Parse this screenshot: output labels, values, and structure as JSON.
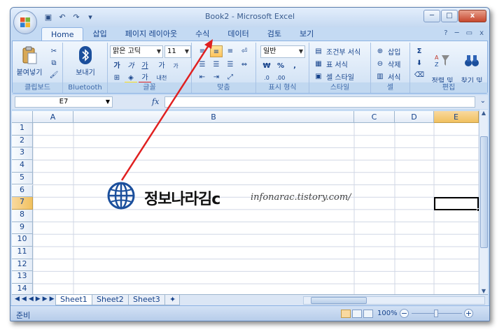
{
  "window": {
    "title": "Book2 - Microsoft Excel",
    "controls": {
      "minimize": "─",
      "restore": "□",
      "close": "x"
    }
  },
  "quick_access": {
    "save": "save-icon",
    "undo": "undo-icon",
    "redo": "redo-icon",
    "customize": "▾"
  },
  "ribbon": {
    "tabs": [
      {
        "label": "Home",
        "active": true
      },
      {
        "label": "삽입"
      },
      {
        "label": "페이지 레이아웃"
      },
      {
        "label": "수식"
      },
      {
        "label": "데이터"
      },
      {
        "label": "검토"
      },
      {
        "label": "보기"
      }
    ],
    "right_controls": {
      "help": "?",
      "minimize": "─",
      "restore": "▭",
      "close": "x"
    },
    "groups": {
      "clipboard": {
        "label": "클립보드",
        "paste": "붙여넣기"
      },
      "bluetooth": {
        "label": "Bluetooth",
        "send": "보내기"
      },
      "font": {
        "label": "글꼴",
        "font_name": "맑은 고딕",
        "font_size": "11",
        "bold": "가",
        "italic": "가",
        "underline": "가",
        "grow": "가",
        "shrink": "가",
        "font_color": "가",
        "phonetic": "내천"
      },
      "alignment": {
        "label": "맞춤"
      },
      "number": {
        "label": "표시 형식",
        "format": "일반",
        "currency": "₩",
        "percent": "%",
        "comma": ",",
        "inc": ".0",
        "dec": ".00"
      },
      "styles": {
        "label": "스타일",
        "conditional": "조건부 서식",
        "table": "표 서식",
        "cell": "셀 스타일"
      },
      "cells": {
        "label": "셀",
        "insert": "삽입",
        "delete": "삭제",
        "format": "서식"
      },
      "editing": {
        "label": "편집",
        "sum": "Σ",
        "sort": "정렬 및\n필터",
        "find": "찾기 및\n선택"
      }
    }
  },
  "formula_bar": {
    "name_box": "E7",
    "fx": "fx",
    "value": ""
  },
  "grid": {
    "columns": [
      "A",
      "B",
      "C",
      "D",
      "E"
    ],
    "selected_column": "E",
    "rows": [
      "1",
      "2",
      "3",
      "4",
      "5",
      "6",
      "7",
      "8",
      "9",
      "10",
      "11",
      "12",
      "13",
      "14"
    ],
    "selected_row": "7",
    "active_cell": "E7"
  },
  "sheets": {
    "tabs": [
      "Sheet1",
      "Sheet2",
      "Sheet3"
    ],
    "active": "Sheet1"
  },
  "status": {
    "text": "준비",
    "zoom": "100%",
    "zoom_level": 1.0
  },
  "watermark": {
    "title": "정보나라김c",
    "url": "infonarac.tistory.com/",
    "icon": "globe-icon"
  },
  "annotation": {
    "color": "#e02020",
    "target": "데이터"
  },
  "colors": {
    "frame": "#c4daf3",
    "ribbon": "#dbe6f5",
    "selection": "#f1c15f"
  }
}
